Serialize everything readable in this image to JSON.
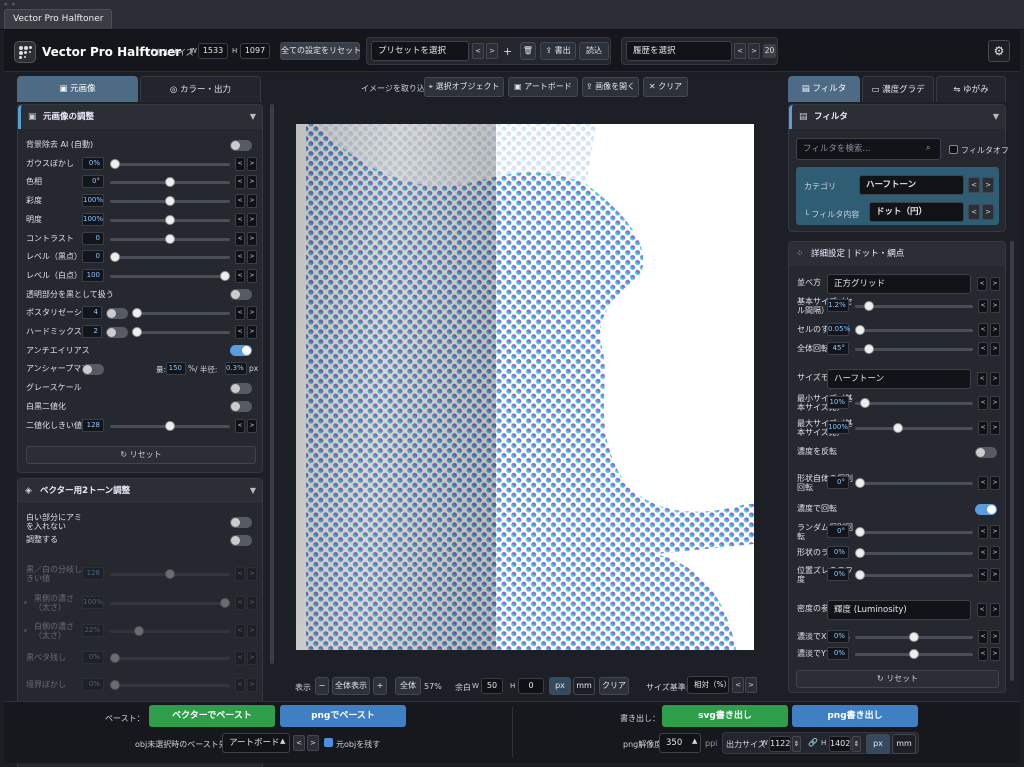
{
  "window": {
    "tab_title": "Vector Pro Halftoner",
    "controls": "« »"
  },
  "header": {
    "app_title": "Vector Pro Halftoner",
    "panel_size_label": "パネルサイズ",
    "w_label": "W",
    "w_value": "1533",
    "h_label": "H",
    "h_value": "1097",
    "reset_all": "全ての設定をリセット",
    "preset_placeholder": "プリセットを選択",
    "prev": "<",
    "next": ">",
    "add": "+",
    "delete_icon": "trash-icon",
    "export_label": "書出",
    "import_label": "読込",
    "history_placeholder": "履歴を選択",
    "history_count": "20"
  },
  "left_tabs": [
    {
      "label": "元画像",
      "icon": "▣"
    },
    {
      "label": "カラー・出力",
      "icon": "◎"
    }
  ],
  "adjust_panel": {
    "title": "元画像の調整",
    "rows": [
      {
        "label": "背景除去 AI (自動)",
        "kind": "toggle",
        "on": false
      },
      {
        "label": "ガウスぼかし",
        "value": "0%",
        "pos": 0.0
      },
      {
        "label": "色相",
        "value": "0°",
        "pos": 0.5
      },
      {
        "label": "彩度",
        "value": "100%",
        "pos": 0.5
      },
      {
        "label": "明度",
        "value": "100%",
        "pos": 0.5
      },
      {
        "label": "コントラスト",
        "value": "0",
        "pos": 0.5
      },
      {
        "label": "レベル（黒点）",
        "value": "0",
        "pos": 0.0
      },
      {
        "label": "レベル（白点）",
        "value": "100",
        "pos": 1.0
      },
      {
        "label": "透明部分を黒として扱う",
        "kind": "toggle",
        "on": false
      },
      {
        "label": "ポスタリゼーション",
        "value": "4",
        "pos": 0.0,
        "toggle": false
      },
      {
        "label": "ハードミックス",
        "value": "2",
        "pos": 0.0,
        "toggle": false
      },
      {
        "label": "アンチエイリアス",
        "kind": "toggle",
        "on": true
      },
      {
        "label": "アンシャープマスク",
        "kind": "unsharp"
      },
      {
        "label": "グレースケール",
        "kind": "toggle",
        "on": false
      },
      {
        "label": "白黒二値化",
        "kind": "toggle",
        "on": false
      },
      {
        "label": "二値化しきい値",
        "value": "128",
        "pos": 0.5
      }
    ],
    "unsharp": {
      "amount_label": "量:",
      "amount": "150",
      "pct": "%",
      "radius_label": "/ 半径:",
      "radius": "0.3%",
      "px": "px"
    },
    "reset": "↻ リセット"
  },
  "vector_panel": {
    "title": "ベクター用2トーン調整",
    "rows": [
      {
        "label": "白い部分にアミを入れない",
        "kind": "toggle",
        "on": false
      },
      {
        "label": "調整する",
        "kind": "toggle",
        "on": false
      },
      {
        "label": "黒／白の分岐しきい値",
        "value": "128",
        "pos": 0.5,
        "dis": true
      },
      {
        "label": "黒側の濃さ（太さ）",
        "value": "100%",
        "pos": 1.0,
        "dis": true,
        "dot": true
      },
      {
        "label": "白側の濃さ（太さ）",
        "value": "22%",
        "pos": 0.22,
        "dis": true,
        "dot": true
      },
      {
        "label": "黒ベタ残し",
        "value": "0%",
        "pos": 0.0,
        "dis": true
      },
      {
        "label": "境界ぼかし",
        "value": "0%",
        "pos": 0.0,
        "dis": true
      }
    ]
  },
  "canvas_toolbar": {
    "label": "イメージを取り込む",
    "buttons": [
      {
        "icon": "target-icon",
        "glyph": "⌖",
        "label": "選択オブジェクト"
      },
      {
        "icon": "artboard-icon",
        "glyph": "▣",
        "label": "アートボード"
      },
      {
        "icon": "open-icon",
        "glyph": "⇪",
        "label": "画像を開く"
      },
      {
        "icon": "clear-icon",
        "glyph": "✕",
        "label": "クリア"
      }
    ]
  },
  "canvas_bottom": {
    "view_label": "表示",
    "zoom_out": "−",
    "fit": "全体表示",
    "zoom_in": "+",
    "all": "全体",
    "zoom": "57%",
    "margin_label": "余白",
    "w_label": "W",
    "w_value": "50",
    "h_label": "H",
    "h_value": "0",
    "unit_px": "px",
    "unit_mm": "mm",
    "clear": "クリア",
    "size_basis_label": "サイズ基準:",
    "size_basis": "相対（%）"
  },
  "right_tabs": [
    {
      "label": "フィルタ",
      "icon": "▤"
    },
    {
      "label": "濃度グラデ",
      "icon": "▭"
    },
    {
      "label": "ゆがみ",
      "icon": "⇋"
    }
  ],
  "filter_panel": {
    "title": "フィルタ",
    "search_placeholder": "フィルタを検索...",
    "filter_off": "フィルタオフ",
    "category_label": "カテゴリ",
    "category_value": "ハーフトーン",
    "content_label": "└ フィルタ内容",
    "content_value": "ドット（円）"
  },
  "detail_panel": {
    "title": "詳細設定 | ドット・網点",
    "rows": [
      {
        "label": "並べ方",
        "kind": "select",
        "value": "正方グリッド"
      },
      {
        "label": "基本サイズ（セル間隔）",
        "value": "1.2%",
        "pos": 0.08
      },
      {
        "label": "セルのすき間",
        "value": "0.05%",
        "pos": 0.0
      },
      {
        "label": "全体回転",
        "value": "45°",
        "pos": 0.08
      },
      {
        "label": "サイズモード",
        "kind": "select",
        "value": "ハーフトーン"
      },
      {
        "label": "最小サイズ（基本サイズ比）",
        "value": "10%",
        "pos": 0.05
      },
      {
        "label": "最大サイズ（基本サイズ比）",
        "value": "100%",
        "pos": 0.35
      },
      {
        "label": "濃度を反転",
        "kind": "toggle",
        "on": false
      },
      {
        "label": "形状自体の個別回転",
        "value": "0°",
        "pos": 0.0
      },
      {
        "label": "濃度で回転",
        "kind": "toggle",
        "on": true
      },
      {
        "label": "ランダム個別回転",
        "value": "0°",
        "pos": 0.0
      },
      {
        "label": "形状のラフ度",
        "value": "0%",
        "pos": 0.0
      },
      {
        "label": "位置ズレのラフ度",
        "value": "0%",
        "pos": 0.0
      },
      {
        "label": "密度の参照元",
        "kind": "select",
        "value": "輝度 (Luminosity)"
      },
      {
        "label": "濃淡でXずらし",
        "value": "0%",
        "pos": 0.5
      },
      {
        "label": "濃淡でYずらし",
        "value": "0%",
        "pos": 0.5
      }
    ],
    "reset": "↻ リセット"
  },
  "bottom": {
    "paste_label": "ペースト：",
    "paste_vector": "ベクターでペースト",
    "paste_png": "pngでペースト",
    "target_label": "obj未選択時のペースト先：",
    "target_value": "アートボード",
    "keep_obj": "元objを残す",
    "export_label": "書き出し：",
    "svg_export": "svg書き出し",
    "png_export": "png書き出し",
    "ppi_label": "png解像度:",
    "ppi_value": "350",
    "ppi_unit": "ppi",
    "out_label": "出力サイズ",
    "w_label": "W",
    "w_value": "1122",
    "h_label": "H",
    "h_value": "1402",
    "unit_px": "px",
    "unit_mm": "mm"
  },
  "colors": {
    "grad_top": "#c23dbf",
    "grad_mid": "#6f7ddb",
    "grad_bottom": "#47e6d6",
    "accent": "#5b9be0"
  }
}
